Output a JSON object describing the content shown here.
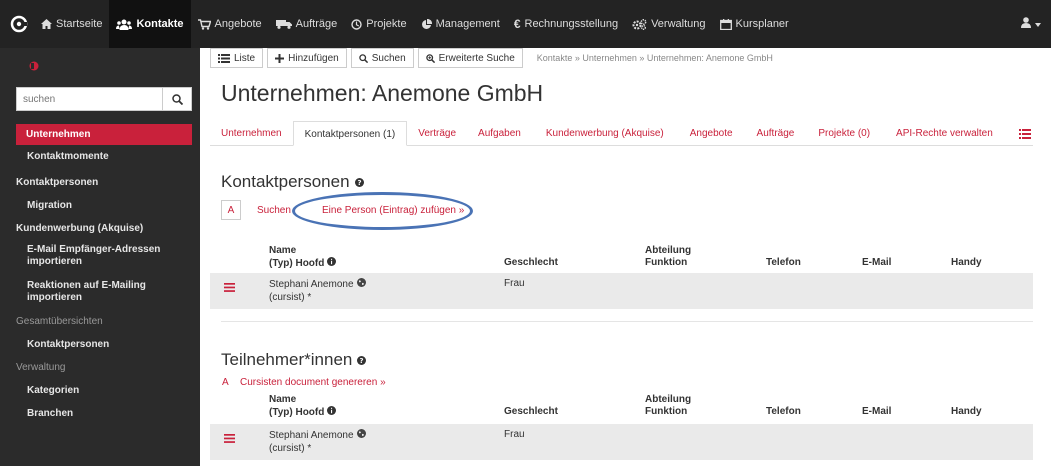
{
  "topnav": {
    "items": [
      {
        "label": "Startseite",
        "icon": "home-icon"
      },
      {
        "label": "Kontakte",
        "icon": "users-icon",
        "active": true
      },
      {
        "label": "Angebote",
        "icon": "cart-icon"
      },
      {
        "label": "Aufträge",
        "icon": "truck-icon"
      },
      {
        "label": "Projekte",
        "icon": "clock-icon"
      },
      {
        "label": "Management",
        "icon": "pie-chart-icon"
      },
      {
        "label": "Rechnungsstellung",
        "icon": "euro-icon"
      },
      {
        "label": "Verwaltung",
        "icon": "cogs-icon"
      },
      {
        "label": "Kursplaner",
        "icon": "calendar-icon"
      }
    ],
    "user_icon": "user-icon"
  },
  "sidebar": {
    "search_placeholder": "suchen",
    "items": [
      {
        "label": "Unternehmen",
        "level": "top",
        "active": true
      },
      {
        "label": "Kontaktmomente",
        "level": "sub"
      },
      {
        "label": "Kontaktpersonen",
        "level": "top"
      },
      {
        "label": "Migration",
        "level": "sub"
      },
      {
        "label": "Kundenwerbung (Akquise)",
        "level": "top"
      },
      {
        "label": "E-Mail Empfänger-Adressen importieren",
        "level": "sub"
      },
      {
        "label": "Reaktionen auf E-Mailing importieren",
        "level": "sub"
      },
      {
        "label": "Gesamtübersichten",
        "level": "head"
      },
      {
        "label": "Kontaktpersonen",
        "level": "sub"
      },
      {
        "label": "Verwaltung",
        "level": "head"
      },
      {
        "label": "Kategorien",
        "level": "sub"
      },
      {
        "label": "Branchen",
        "level": "sub"
      }
    ]
  },
  "toolbar": {
    "list_label": "Liste",
    "add_label": "Hinzufügen",
    "search_label": "Suchen",
    "advanced_search_label": "Erweiterte Suche",
    "breadcrumb": "Kontakte » Unternehmen » Unternehmen: Anemone GmbH"
  },
  "page": {
    "title": "Unternehmen: Anemone GmbH"
  },
  "tabs": [
    {
      "label": "Unternehmen"
    },
    {
      "label": "Kontaktpersonen (1)",
      "active": true
    },
    {
      "label": "Verträge"
    },
    {
      "label": "Aufgaben"
    },
    {
      "label": "Kundenwerbung (Akquise)"
    },
    {
      "label": "Angebote"
    },
    {
      "label": "Aufträge"
    },
    {
      "label": "Projekte (0)"
    },
    {
      "label": "API-Rechte verwalten"
    }
  ],
  "kontaktpersonen": {
    "title": "Kontaktpersonen",
    "alpha_button": "A",
    "search_link": "Suchen",
    "add_link": "Eine Person (Eintrag) zufügen »",
    "columns": {
      "name": "Name",
      "type": "(Typ) Hoofd",
      "gender": "Geschlecht",
      "department": "Abteilung",
      "function": "Funktion",
      "phone": "Telefon",
      "email": "E-Mail",
      "mobile": "Handy"
    },
    "rows": [
      {
        "name": "Stephani Anemone",
        "type": "(cursist) *",
        "gender": "Frau"
      }
    ]
  },
  "teilnehmer": {
    "title": "Teilnehmer*innen",
    "alpha_link": "A",
    "generate_link": "Cursisten document genereren »",
    "columns": {
      "name": "Name",
      "type": "(Typ) Hoofd",
      "gender": "Geschlecht",
      "department": "Abteilung",
      "function": "Funktion",
      "phone": "Telefon",
      "email": "E-Mail",
      "mobile": "Handy"
    },
    "rows": [
      {
        "name": "Stephani Anemone",
        "type": "(cursist) *",
        "gender": "Frau"
      }
    ]
  },
  "colors": {
    "accent": "#c9213b",
    "navbar": "#232323",
    "sidebar": "#2b2b2b",
    "highlight": "#4a73b5"
  }
}
